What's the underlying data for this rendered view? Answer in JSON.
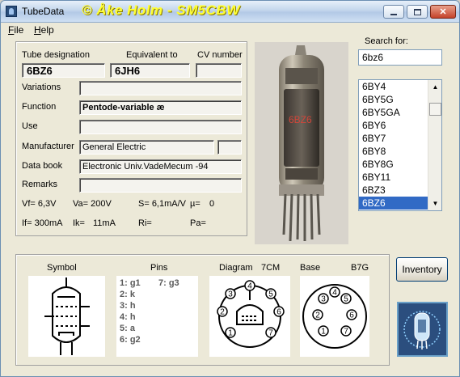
{
  "window": {
    "title": "TubeData",
    "banner": "© Åke Holm - SM5CBW",
    "controls": [
      "minimize",
      "maximize",
      "close"
    ]
  },
  "menu": [
    {
      "label": "File",
      "underline": "F"
    },
    {
      "label": "Help",
      "underline": "H"
    }
  ],
  "form": {
    "tube_designation": {
      "label": "Tube designation",
      "value": "6BZ6"
    },
    "equivalent_to": {
      "label": "Equivalent to",
      "value": "6JH6"
    },
    "cv_number": {
      "label": "CV number",
      "value": ""
    },
    "variations": {
      "label": "Variations",
      "value": ""
    },
    "function": {
      "label": "Function",
      "value": "Pentode-variable æ"
    },
    "use": {
      "label": "Use",
      "value": ""
    },
    "manufacturer": {
      "label": "Manufacturer",
      "value": "General Electric",
      "extra": ""
    },
    "data_book": {
      "label": "Data book",
      "value": "Electronic Univ.VadeMecum -94"
    },
    "remarks": {
      "label": "Remarks",
      "value": ""
    }
  },
  "params": {
    "vf": "Vf= 6,3V",
    "va": "Va= 200V",
    "s": "S= 6,1mA/V",
    "mu": "µ=",
    "mu_val": "0",
    "if": "If= 300mA",
    "ik": "Ik=",
    "ik_val": "11mA",
    "ri": "Ri=",
    "pa": "Pa="
  },
  "search": {
    "label": "Search for:",
    "value": "6bz6"
  },
  "tube_list": {
    "items": [
      "6BY4",
      "6BY5G",
      "6BY5GA",
      "6BY6",
      "6BY7",
      "6BY8",
      "6BY8G",
      "6BY11",
      "6BZ3",
      "6BZ6"
    ],
    "selected": "6BZ6"
  },
  "photo": {
    "tube_print": "6BZ6"
  },
  "bottom": {
    "symbol_title": "Symbol",
    "pins_title": "Pins",
    "diagram_title": "Diagram",
    "diagram_code": "7CM",
    "base_title": "Base",
    "base_code": "B7G",
    "pins": [
      "1: g1",
      "7: g3",
      "2: k",
      "3: h",
      "4: h",
      "5: a",
      "6: g2"
    ],
    "diagram_pins": [
      "1",
      "2",
      "3",
      "4",
      "5",
      "6",
      "7"
    ]
  },
  "inventory_button": "Inventory",
  "colors": {
    "banner_yellow": "#ffff33",
    "list_selection": "#316ac5",
    "window_bg": "#ece9d8",
    "logo_bg": "#2b4e7e"
  },
  "icons": [
    "tube-app-icon",
    "minimize-icon",
    "maximize-icon",
    "close-icon",
    "tube-logo-icon"
  ]
}
